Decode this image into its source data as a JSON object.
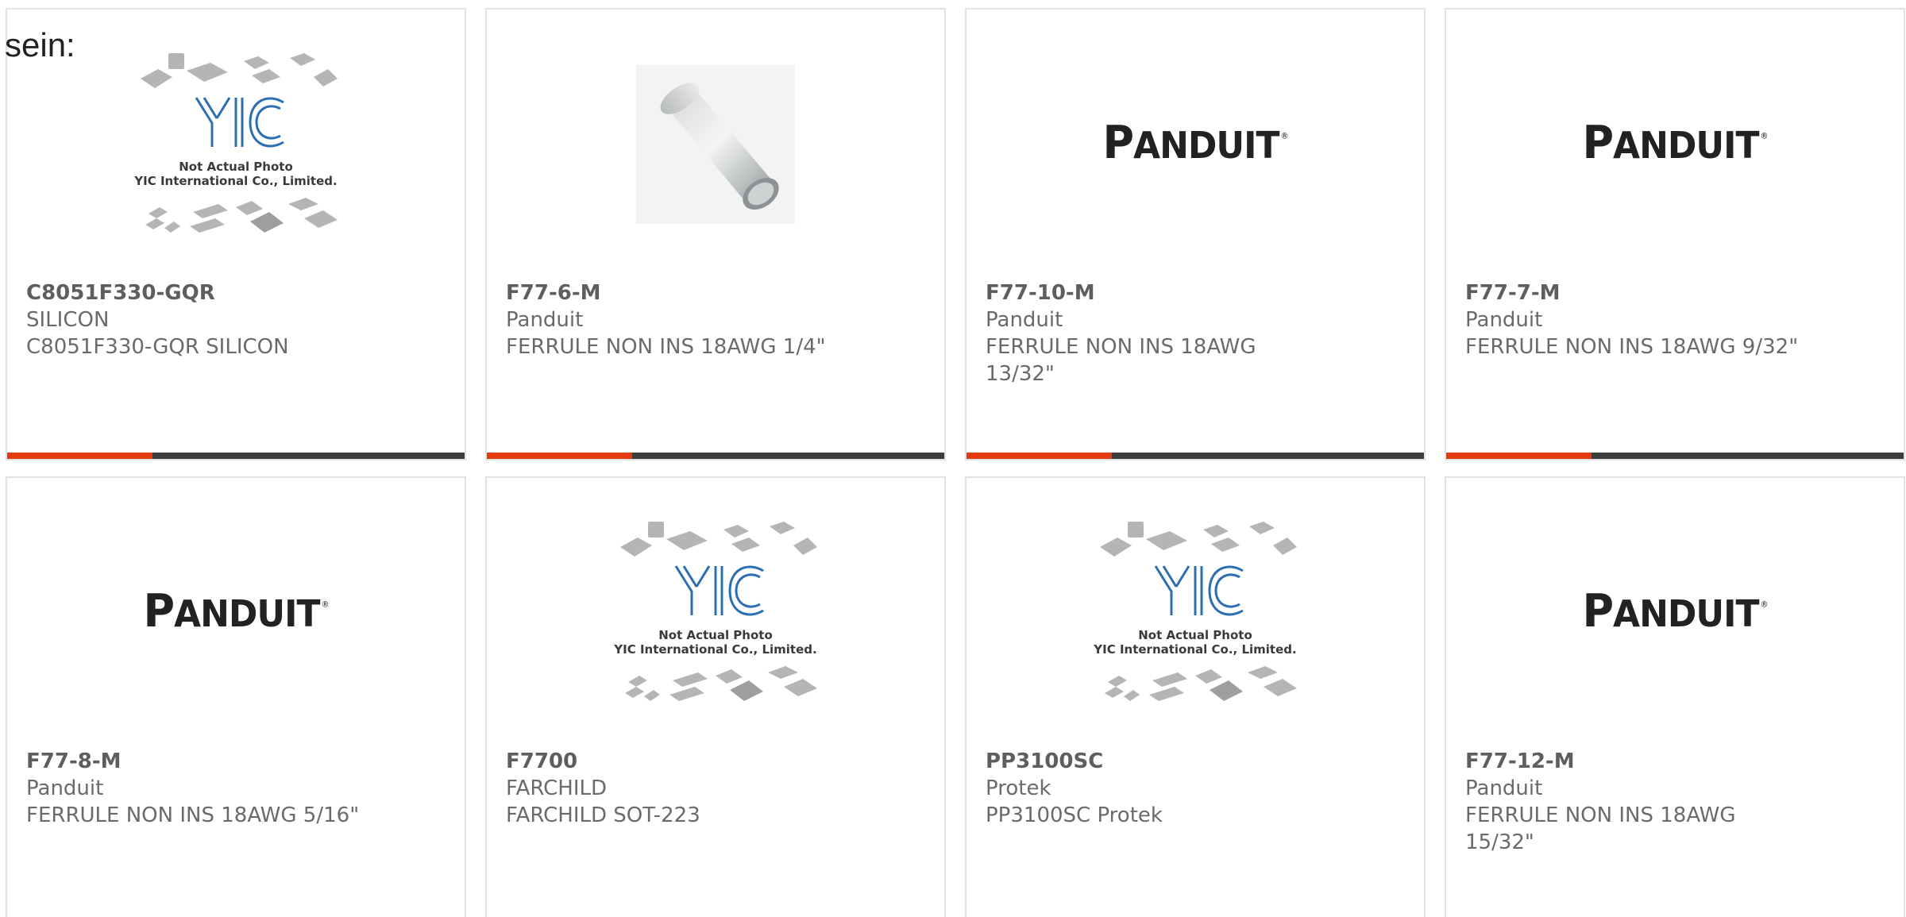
{
  "intro": {
    "text": "sein:"
  },
  "colors": {
    "accent": "#e33a12",
    "bar": "#3d3d3d",
    "card_border": "#e2e2e2",
    "text": "#6a6a6a"
  },
  "placeholder_image": {
    "line1": "Not Actual Photo",
    "line2": "YIC International Co., Limited.",
    "logo_text": "YIC"
  },
  "brand_logo": {
    "text": "PANDUIT",
    "first_letter": "P",
    "rest": "ANDUIT",
    "mark": "®"
  },
  "products": [
    {
      "part": "C8051F330-GQR",
      "manufacturer": "SILICON",
      "description": "C8051F330-GQR SILICON",
      "image": "yic-placeholder"
    },
    {
      "part": "F77-6-M",
      "manufacturer": "Panduit",
      "description": "FERRULE NON INS 18AWG 1/4\"",
      "image": "ferrule-photo"
    },
    {
      "part": "F77-10-M",
      "manufacturer": "Panduit",
      "description": "FERRULE NON INS 18AWG 13/32\"",
      "image": "panduit-logo"
    },
    {
      "part": "F77-7-M",
      "manufacturer": "Panduit",
      "description": "FERRULE NON INS 18AWG 9/32\"",
      "image": "panduit-logo"
    },
    {
      "part": "F77-8-M",
      "manufacturer": "Panduit",
      "description": "FERRULE NON INS 18AWG 5/16\"",
      "image": "panduit-logo"
    },
    {
      "part": "F7700",
      "manufacturer": "FARCHILD",
      "description": "FARCHILD SOT-223",
      "image": "yic-placeholder"
    },
    {
      "part": "PP3100SC",
      "manufacturer": "Protek",
      "description": "PP3100SC Protek",
      "image": "yic-placeholder"
    },
    {
      "part": "F77-12-M",
      "manufacturer": "Panduit",
      "description": "FERRULE NON INS 18AWG 15/32\"",
      "image": "panduit-logo"
    }
  ]
}
